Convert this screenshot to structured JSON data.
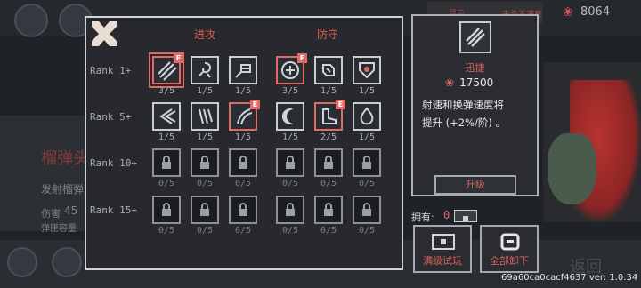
{
  "hud": {
    "gem_count": "8064",
    "top_badge_left": "显示",
    "top_badge_right": "击杀不满意"
  },
  "background": {
    "title": "榴弹头",
    "line1": "发射榴弹",
    "line2_label": "伤害",
    "line2_value": "45",
    "line3": "弹匣容量",
    "ghost_text": "返回"
  },
  "dialog": {
    "col_attack": "进攻",
    "col_defense": "防守",
    "rows": [
      {
        "label": "Rank 1+",
        "slots": [
          {
            "icon": "stripes-icon",
            "count": "3/5",
            "locked": false,
            "red": true,
            "e": true,
            "selected": true
          },
          {
            "icon": "swirl-icon",
            "count": "1/5",
            "locked": false,
            "red": false,
            "e": false,
            "selected": false
          },
          {
            "icon": "fist-icon",
            "count": "1/5",
            "locked": false,
            "red": false,
            "e": false,
            "selected": false
          },
          {
            "icon": "shield-cross-icon",
            "count": "3/5",
            "locked": false,
            "red": true,
            "e": true,
            "selected": false
          },
          {
            "icon": "armored-arm-icon",
            "count": "1/5",
            "locked": false,
            "red": false,
            "e": false,
            "selected": false
          },
          {
            "icon": "heart-shield-icon",
            "count": "1/5",
            "locked": false,
            "red": false,
            "e": false,
            "selected": false
          }
        ]
      },
      {
        "label": "Rank 5+",
        "slots": [
          {
            "icon": "arrows-icon",
            "count": "1/5",
            "locked": false,
            "red": false,
            "e": false,
            "selected": false
          },
          {
            "icon": "claw-icon",
            "count": "1/5",
            "locked": false,
            "red": false,
            "e": false,
            "selected": false
          },
          {
            "icon": "slash-icon",
            "count": "1/5",
            "locked": false,
            "red": true,
            "e": true,
            "selected": false
          },
          {
            "icon": "crescent-icon",
            "count": "1/5",
            "locked": false,
            "red": false,
            "e": false,
            "selected": false
          },
          {
            "icon": "boot-icon",
            "count": "2/5",
            "locked": false,
            "red": true,
            "e": true,
            "selected": false
          },
          {
            "icon": "flame-drop-icon",
            "count": "1/5",
            "locked": false,
            "red": false,
            "e": false,
            "selected": false
          }
        ]
      },
      {
        "label": "Rank 10+",
        "slots": [
          {
            "icon": "lock-icon",
            "count": "0/5",
            "locked": true,
            "red": false,
            "e": false,
            "selected": false
          },
          {
            "icon": "lock-icon",
            "count": "0/5",
            "locked": true,
            "red": false,
            "e": false,
            "selected": false
          },
          {
            "icon": "lock-icon",
            "count": "0/5",
            "locked": true,
            "red": false,
            "e": false,
            "selected": false
          },
          {
            "icon": "lock-icon",
            "count": "0/5",
            "locked": true,
            "red": false,
            "e": false,
            "selected": false
          },
          {
            "icon": "lock-icon",
            "count": "0/5",
            "locked": true,
            "red": false,
            "e": false,
            "selected": false
          },
          {
            "icon": "lock-icon",
            "count": "0/5",
            "locked": true,
            "red": false,
            "e": false,
            "selected": false
          }
        ]
      },
      {
        "label": "Rank 15+",
        "slots": [
          {
            "icon": "lock-icon",
            "count": "0/5",
            "locked": true,
            "red": false,
            "e": false,
            "selected": false
          },
          {
            "icon": "lock-icon",
            "count": "0/5",
            "locked": true,
            "red": false,
            "e": false,
            "selected": false
          },
          {
            "icon": "lock-icon",
            "count": "0/5",
            "locked": true,
            "red": false,
            "e": false,
            "selected": false
          },
          {
            "icon": "lock-icon",
            "count": "0/5",
            "locked": true,
            "red": false,
            "e": false,
            "selected": false
          },
          {
            "icon": "lock-icon",
            "count": "0/5",
            "locked": true,
            "red": false,
            "e": false,
            "selected": false
          },
          {
            "icon": "lock-icon",
            "count": "0/5",
            "locked": true,
            "red": false,
            "e": false,
            "selected": false
          }
        ]
      }
    ]
  },
  "detail": {
    "name": "迅捷",
    "cost": "17500",
    "description_line1": "射速和换弹速度将",
    "description_line2": "提升 (+2%/阶) 。",
    "upgrade_label": "升级"
  },
  "owned": {
    "label": "拥有:",
    "count": "0"
  },
  "actions": {
    "trial_label": "满级试玩",
    "unequip_label": "全部卸下"
  },
  "version": "69a60ca0cacf4637 ver: 1.0.34",
  "colors": {
    "accent_red": "#e06a65",
    "border_light": "#cfd3d8",
    "panel_bg": "#27292e"
  }
}
